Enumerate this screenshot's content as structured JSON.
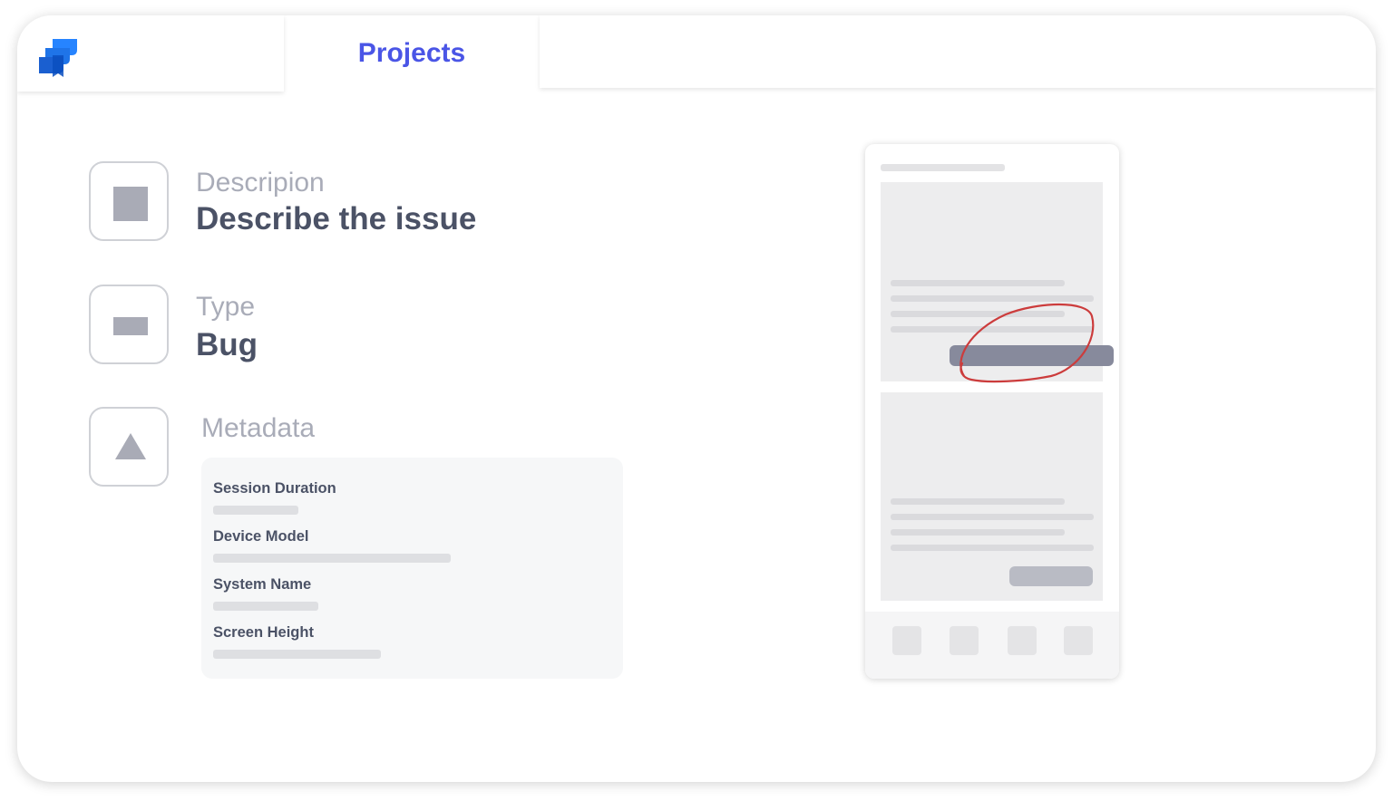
{
  "header": {
    "logo_icon": "jira-logo-icon",
    "tab_label": "Projects",
    "accent_color": "#4a55e6"
  },
  "fields": {
    "description": {
      "label": "Descripion",
      "value": "Describe the issue",
      "icon": "square-icon"
    },
    "type": {
      "label": "Type",
      "value": "Bug",
      "icon": "rectangle-icon"
    },
    "metadata": {
      "label": "Metadata",
      "icon": "triangle-icon"
    }
  },
  "metadata": {
    "items": [
      {
        "name": "Session Duration"
      },
      {
        "name": "Device Model"
      },
      {
        "name": "System Name"
      },
      {
        "name": "Screen Height"
      }
    ]
  },
  "phone_mockup": {
    "annotation_color": "#cc3c3c",
    "nav_icons": [
      "nav-icon-1",
      "nav-icon-2",
      "nav-icon-3",
      "nav-icon-4"
    ]
  }
}
